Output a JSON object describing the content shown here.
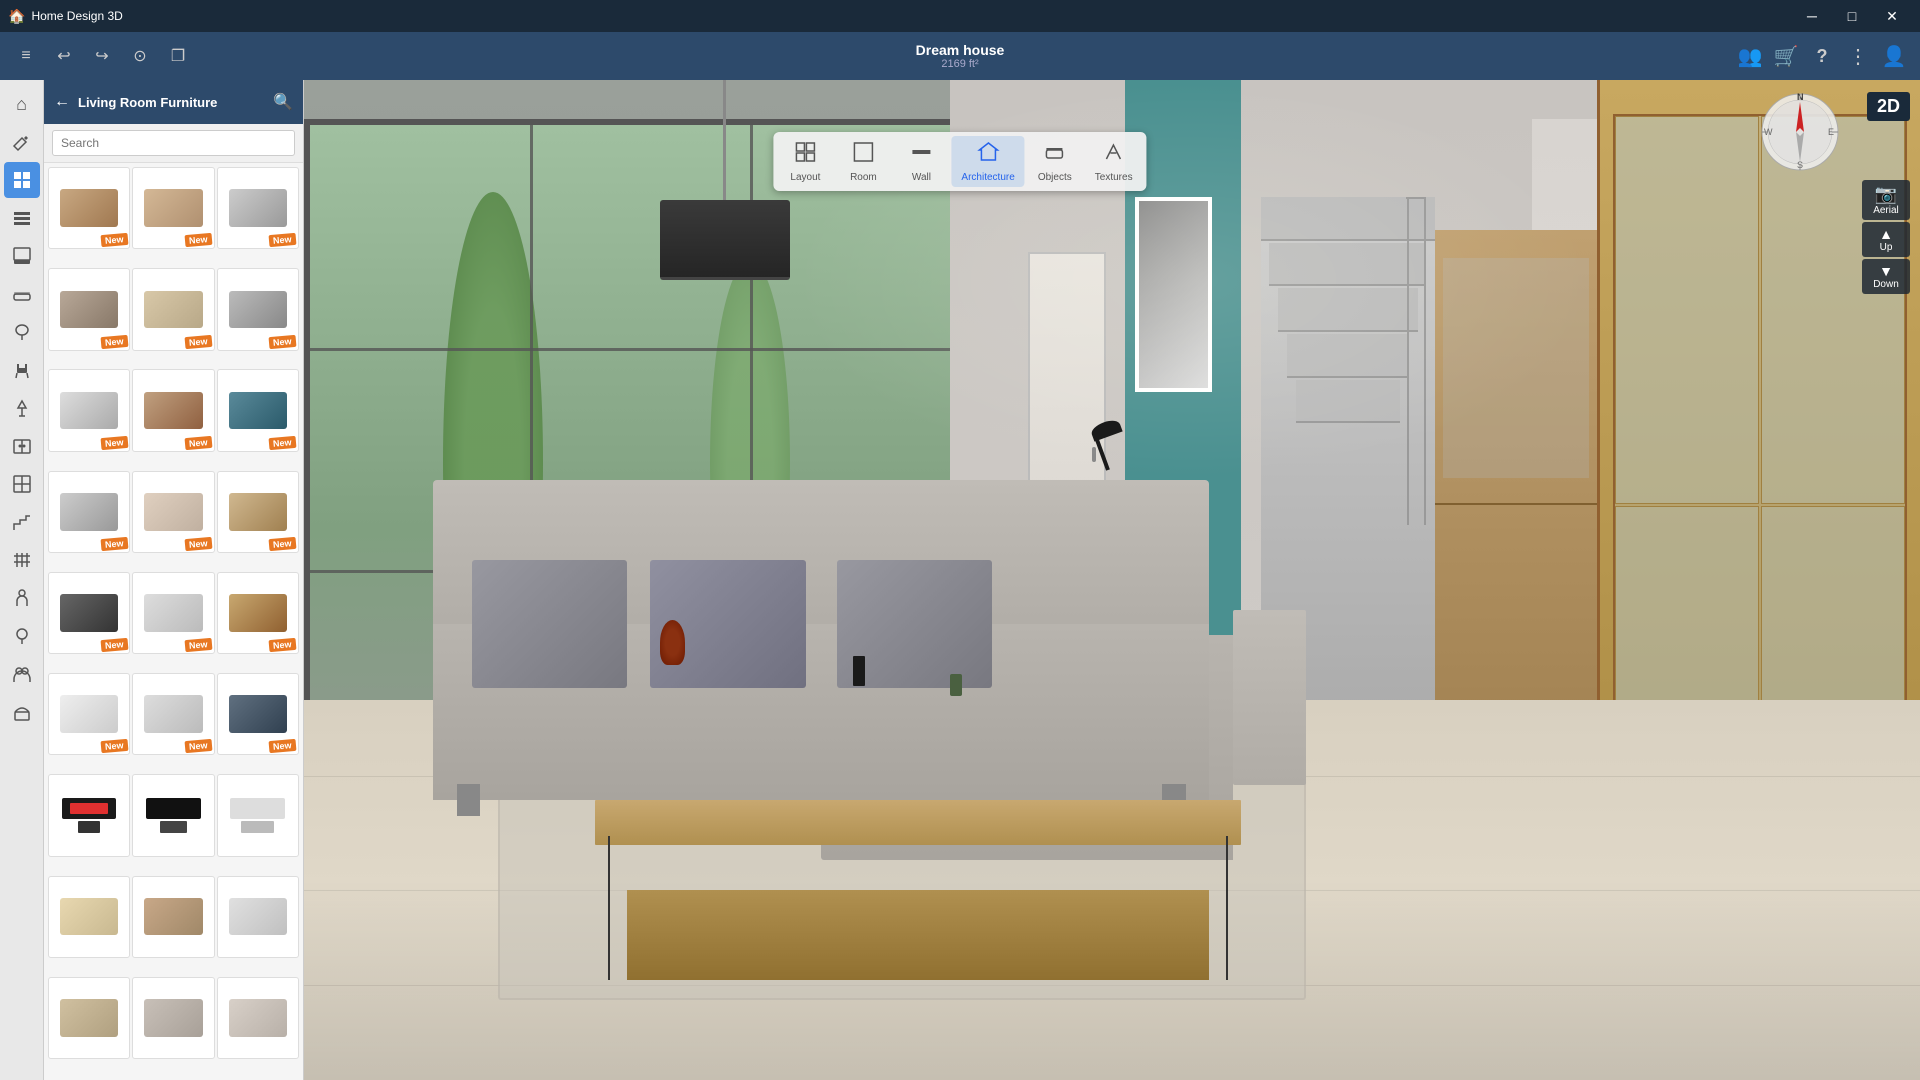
{
  "app": {
    "title": "Home Design 3D",
    "minimize": "─",
    "maximize": "□",
    "close": "✕"
  },
  "toolbar": {
    "menu_icon": "≡",
    "undo": "↩",
    "redo": "↪",
    "history": "⊙",
    "copy": "❐"
  },
  "project": {
    "name": "Dream house",
    "size": "2169 ft²"
  },
  "modes": [
    {
      "id": "layout",
      "label": "Layout",
      "icon": "⬜"
    },
    {
      "id": "room",
      "label": "Room",
      "icon": "⬛"
    },
    {
      "id": "wall",
      "label": "Wall",
      "icon": "▭"
    },
    {
      "id": "architecture",
      "label": "Architecture",
      "icon": "🏠"
    },
    {
      "id": "objects",
      "label": "Objects",
      "icon": "🪑"
    },
    {
      "id": "textures",
      "label": "Textures",
      "icon": "🖌"
    }
  ],
  "right_toolbar": {
    "users": "👥",
    "shop": "🛒",
    "help": "?",
    "more": "⋮",
    "account": "👤"
  },
  "sidebar_icons": [
    {
      "id": "home",
      "icon": "⌂",
      "active": false
    },
    {
      "id": "ruler",
      "icon": "📐",
      "active": false
    },
    {
      "id": "grid",
      "icon": "⊞",
      "active": true
    },
    {
      "id": "layers",
      "icon": "≡",
      "active": false
    },
    {
      "id": "paint",
      "icon": "⊡",
      "active": false
    },
    {
      "id": "sofa",
      "icon": "🛋",
      "active": false
    },
    {
      "id": "tree",
      "icon": "🌿",
      "active": false
    },
    {
      "id": "chair",
      "icon": "🪑",
      "active": false
    },
    {
      "id": "lamp",
      "icon": "💡",
      "active": false
    },
    {
      "id": "bookshelf",
      "icon": "📚",
      "active": false
    },
    {
      "id": "cabinet",
      "icon": "🗄",
      "active": false
    },
    {
      "id": "stairs",
      "icon": "⊞",
      "active": false
    },
    {
      "id": "window",
      "icon": "⬜",
      "active": false
    },
    {
      "id": "door",
      "icon": "🚪",
      "active": false
    },
    {
      "id": "kitchen",
      "icon": "🍳",
      "active": false
    },
    {
      "id": "bathroom",
      "icon": "🛁",
      "active": false
    },
    {
      "id": "person",
      "icon": "👤",
      "active": false
    },
    {
      "id": "outdoor",
      "icon": "🌳",
      "active": false
    }
  ],
  "catalog": {
    "title": "Living Room Furniture",
    "back_icon": "←",
    "search_icon": "🔍",
    "search_placeholder": "Search"
  },
  "items": [
    {
      "id": 1,
      "style": "furn-1",
      "new": true
    },
    {
      "id": 2,
      "style": "furn-2",
      "new": true
    },
    {
      "id": 3,
      "style": "furn-3",
      "new": true
    },
    {
      "id": 4,
      "style": "furn-4",
      "new": true
    },
    {
      "id": 5,
      "style": "furn-5",
      "new": true
    },
    {
      "id": 6,
      "style": "furn-6",
      "new": true
    },
    {
      "id": 7,
      "style": "furn-7",
      "new": true
    },
    {
      "id": 8,
      "style": "furn-8",
      "new": true
    },
    {
      "id": 9,
      "style": "furn-9",
      "new": true
    },
    {
      "id": 10,
      "style": "furn-10",
      "new": true
    },
    {
      "id": 11,
      "style": "furn-11",
      "new": true
    },
    {
      "id": 12,
      "style": "furn-12",
      "new": true
    },
    {
      "id": 13,
      "style": "furn-13",
      "new": true
    },
    {
      "id": 14,
      "style": "furn-14",
      "new": true
    },
    {
      "id": 15,
      "style": "furn-15",
      "new": true
    },
    {
      "id": 16,
      "style": "furn-16",
      "new": true
    },
    {
      "id": 17,
      "style": "furn-17",
      "new": true
    },
    {
      "id": 18,
      "style": "furn-18",
      "new": true
    },
    {
      "id": 19,
      "style": "furn-tv1",
      "new": false
    },
    {
      "id": 20,
      "style": "furn-tv2",
      "new": false
    },
    {
      "id": 21,
      "style": "furn-tv3",
      "new": false
    },
    {
      "id": 22,
      "style": "furn-1",
      "new": false
    },
    {
      "id": 23,
      "style": "furn-2",
      "new": false
    },
    {
      "id": 24,
      "style": "furn-3",
      "new": false
    }
  ],
  "new_badge_text": "New",
  "view": {
    "compass_n": "N",
    "compass_s": "S",
    "compass_e": "E",
    "compass_w": "W",
    "btn_2d": "2D",
    "btn_aerial": "Aerial",
    "btn_up": "Up",
    "btn_down": "Down",
    "aerial_icon": "📷",
    "up_icon": "▲",
    "down_icon": "▼"
  }
}
